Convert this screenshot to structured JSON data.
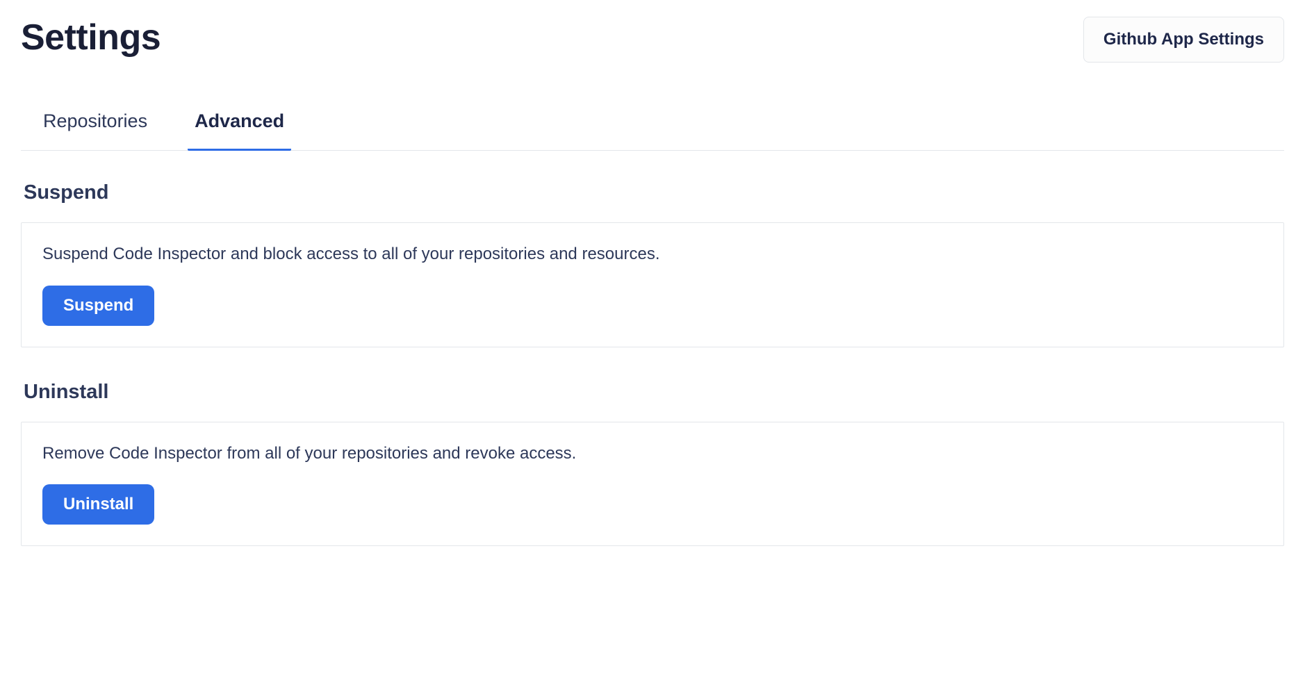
{
  "header": {
    "title": "Settings",
    "github_app_button_label": "Github App Settings"
  },
  "tabs": [
    {
      "label": "Repositories",
      "active": false
    },
    {
      "label": "Advanced",
      "active": true
    }
  ],
  "sections": {
    "suspend": {
      "title": "Suspend",
      "description": "Suspend Code Inspector and block access to all of your repositories and resources.",
      "button_label": "Suspend"
    },
    "uninstall": {
      "title": "Uninstall",
      "description": "Remove Code Inspector from all of your repositories and revoke access.",
      "button_label": "Uninstall"
    }
  }
}
